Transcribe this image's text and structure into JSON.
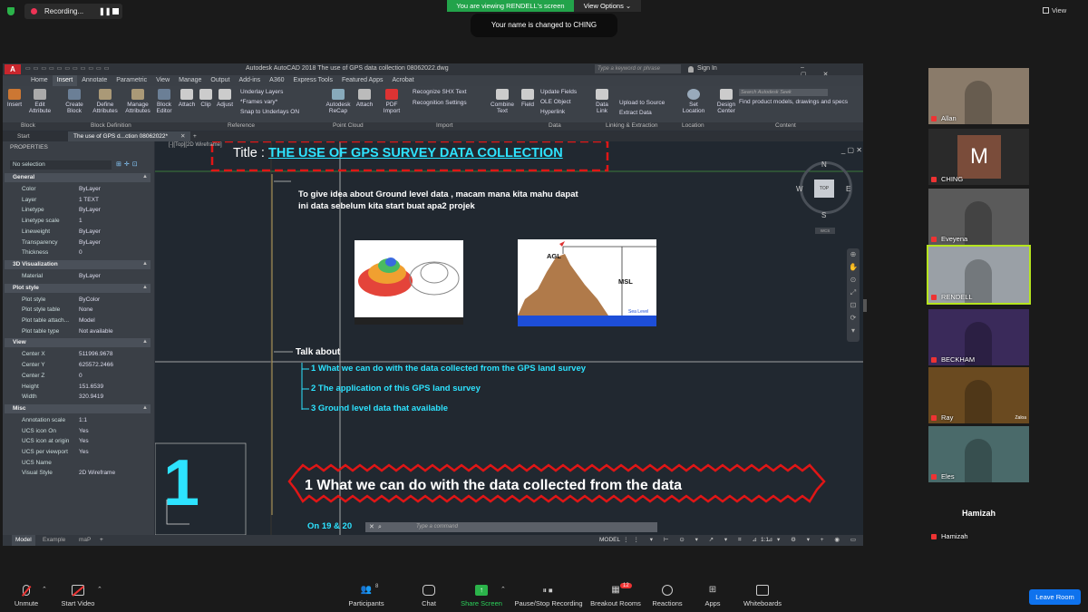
{
  "zoom": {
    "recording_label": "Recording...",
    "banner": "You are viewing RENDELL's screen",
    "view_options": "View Options",
    "toast": "Your name is changed to CHING",
    "view_label": "View",
    "toolbar": {
      "unmute": "Unmute",
      "start_video": "Start Video",
      "participants": "Participants",
      "participants_count": "8",
      "chat": "Chat",
      "share_screen": "Share Screen",
      "pause_recording": "Pause/Stop Recording",
      "breakout_rooms": "Breakout Rooms",
      "breakout_count": "12",
      "reactions": "Reactions",
      "apps": "Apps",
      "whiteboards": "Whiteboards",
      "leave": "Leave Room"
    },
    "participants": [
      {
        "name": "Allan",
        "color": "#8a7b6a"
      },
      {
        "name": "CHING",
        "initial": "M",
        "color": "#6e4e3f"
      },
      {
        "name": "Eveyena",
        "color": "#5a5a5a"
      },
      {
        "name": "RENDELL",
        "color": "#9aa0a6",
        "active": true
      },
      {
        "name": "BECKHAM",
        "color": "#3a2a5a"
      },
      {
        "name": "Ray",
        "color": "#6a4a20",
        "tag": "Zaloa"
      },
      {
        "name": "Eles",
        "color": "#4a6a6a"
      },
      {
        "name": "Hamizah",
        "color": "#1a1a1a",
        "center_text": "Hamizah"
      }
    ]
  },
  "autocad": {
    "window_title": "Autodesk AutoCAD 2018   The use of GPS data collection 08062022.dwg",
    "search_placeholder": "Type a keyword or phrase",
    "sign_in": "Sign In",
    "menu": [
      "Home",
      "Insert",
      "Annotate",
      "Parametric",
      "View",
      "Manage",
      "Output",
      "Add-ins",
      "A360",
      "Express Tools",
      "Featured Apps",
      "Acrobat"
    ],
    "menu_active": "Insert",
    "ribbon": {
      "insert": "Insert",
      "edit_attribute": "Edit Attribute",
      "create_block": "Create Block",
      "define_attributes": "Define Attributes",
      "manage_attributes": "Manage Attributes",
      "block_editor": "Block Editor",
      "attach": "Attach",
      "clip": "Clip",
      "adjust": "Adjust",
      "underlay_layers": "Underlay Layers",
      "frames_vary": "*Frames vary*",
      "snap_underlays": "Snap to Underlays ON",
      "recap": "Autodesk ReCap",
      "attach2": "Attach",
      "pdf_import": "PDF Import",
      "recognize_shx": "Recognize SHX Text",
      "recognition_settings": "Recognition Settings",
      "combine_text": "Combine Text",
      "field": "Field",
      "update_fields": "Update Fields",
      "ole_object": "OLE Object",
      "hyperlink": "Hyperlink",
      "data_link": "Data Link",
      "upload_source": "Upload to Source",
      "extract_data": "Extract  Data",
      "set_location": "Set Location",
      "design_center": "Design Center",
      "search_seek": "Search Autodesk Seek",
      "find_products": "Find product models, drawings and specs",
      "panels": [
        "Block",
        "Block Definition",
        "Reference",
        "Point Cloud",
        "Import",
        "Data",
        "Linking & Extraction",
        "Location",
        "Content"
      ]
    },
    "tabs": [
      "Start",
      "The use of GPS d...ction 08062022*"
    ],
    "properties": {
      "title": "PROPERTIES",
      "selection": "No selection",
      "sections": [
        {
          "name": "General",
          "rows": [
            [
              "Color",
              "ByLayer"
            ],
            [
              "Layer",
              "1 TEXT"
            ],
            [
              "Linetype",
              "ByLayer"
            ],
            [
              "Linetype scale",
              "1"
            ],
            [
              "Lineweight",
              "ByLayer"
            ],
            [
              "Transparency",
              "ByLayer"
            ],
            [
              "Thickness",
              "0"
            ]
          ]
        },
        {
          "name": "3D Visualization",
          "rows": [
            [
              "Material",
              "ByLayer"
            ]
          ]
        },
        {
          "name": "Plot style",
          "rows": [
            [
              "Plot style",
              "ByColor"
            ],
            [
              "Plot style table",
              "None"
            ],
            [
              "Plot table attach...",
              "Model"
            ],
            [
              "Plot table type",
              "Not available"
            ]
          ]
        },
        {
          "name": "View",
          "rows": [
            [
              "Center X",
              "511996.9678"
            ],
            [
              "Center Y",
              "625572.2466"
            ],
            [
              "Center Z",
              "0"
            ],
            [
              "Height",
              "151.6539"
            ],
            [
              "Width",
              "320.9419"
            ]
          ]
        },
        {
          "name": "Misc",
          "rows": [
            [
              "Annotation scale",
              "1:1"
            ],
            [
              "UCS icon On",
              "Yes"
            ],
            [
              "UCS icon at origin",
              "Yes"
            ],
            [
              "UCS per viewport",
              "Yes"
            ],
            [
              "UCS Name",
              ""
            ],
            [
              "Visual Style",
              "2D Wireframe"
            ]
          ]
        }
      ]
    },
    "canvas": {
      "viewport_label": "[-][Top][2D Wireframe]",
      "title_prefix": "Title : ",
      "title_main": "THE USE OF GPS SURVEY DATA COLLECTION",
      "intro_line1": "To give idea about Ground level data , macam mana kita mahu dapat",
      "intro_line2": "ini data sebelum kita start buat apa2 projek",
      "agl": "AGL",
      "msl": "MSL",
      "sea_level": "Sea Level",
      "talk_about": "Talk about",
      "items": [
        "1 What we can do with the data collected from the GPS land survey",
        "2 The application of this GPS land survey",
        "3 Ground level data that available"
      ],
      "big_heading": "1 What we can do with the data collected from the data",
      "big_number": "1",
      "bottom_line": "On 19 & 20",
      "command_placeholder": "Type a command",
      "compass": {
        "n": "N",
        "s": "S",
        "e": "E",
        "w": "W",
        "top": "TOP",
        "wcs": "WCS"
      }
    },
    "status": {
      "model_tab": "Model",
      "example_tab": "Example",
      "map_tab": "maP",
      "model_btn": "MODEL",
      "scale": "1:1"
    }
  }
}
